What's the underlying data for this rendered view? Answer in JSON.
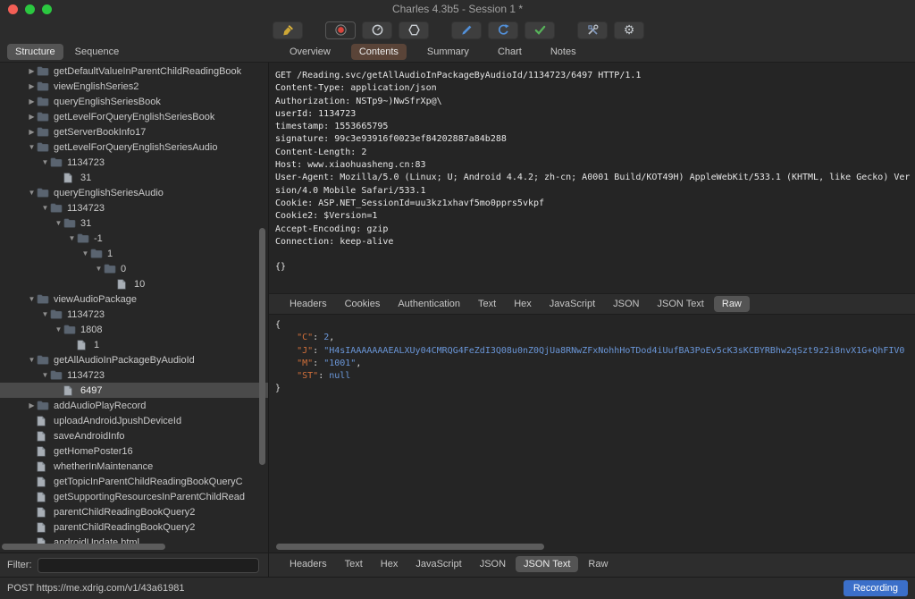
{
  "window": {
    "title": "Charles 4.3b5 - Session 1 *"
  },
  "toolbar": {
    "buttons": [
      {
        "name": "clear",
        "icon": "broom-icon",
        "active": false
      },
      {
        "name": "record",
        "icon": "record-icon",
        "active": true
      },
      {
        "name": "throttle",
        "icon": "throttle-icon",
        "active": false
      },
      {
        "name": "breakpoints",
        "icon": "breakpoints-hexagon-icon",
        "active": false
      },
      {
        "name": "compose",
        "icon": "compose-pencil-icon",
        "active": false
      },
      {
        "name": "repeat",
        "icon": "repeat-arrow-icon",
        "active": false
      },
      {
        "name": "validate",
        "icon": "validate-check-icon",
        "active": false
      },
      {
        "name": "tools",
        "icon": "tools-icon",
        "active": false
      },
      {
        "name": "settings",
        "icon": "settings-gear-icon",
        "active": false
      }
    ]
  },
  "main_tabs": {
    "items": [
      "Overview",
      "Contents",
      "Summary",
      "Chart",
      "Notes"
    ],
    "selected": "Contents"
  },
  "sidebar": {
    "tabs": {
      "items": [
        "Structure",
        "Sequence"
      ],
      "selected": "Structure"
    },
    "tree": [
      {
        "label": "getDefaultValueInParentChildReadingBook",
        "depth": 0,
        "kind": "folder",
        "state": "collapsed",
        "selected": false
      },
      {
        "label": "viewEnglishSeries2",
        "depth": 0,
        "kind": "folder",
        "state": "collapsed",
        "selected": false
      },
      {
        "label": "queryEnglishSeriesBook",
        "depth": 0,
        "kind": "folder",
        "state": "collapsed",
        "selected": false
      },
      {
        "label": "getLevelForQueryEnglishSeriesBook",
        "depth": 0,
        "kind": "folder",
        "state": "collapsed",
        "selected": false
      },
      {
        "label": "getServerBookInfo17",
        "depth": 0,
        "kind": "folder",
        "state": "collapsed",
        "selected": false
      },
      {
        "label": "getLevelForQueryEnglishSeriesAudio",
        "depth": 0,
        "kind": "folder",
        "state": "expanded",
        "selected": false
      },
      {
        "label": "1134723",
        "depth": 1,
        "kind": "folder",
        "state": "expanded",
        "selected": false
      },
      {
        "label": "31",
        "depth": 2,
        "kind": "file",
        "selected": false
      },
      {
        "label": "queryEnglishSeriesAudio",
        "depth": 0,
        "kind": "folder",
        "state": "expanded",
        "selected": false
      },
      {
        "label": "1134723",
        "depth": 1,
        "kind": "folder",
        "state": "expanded",
        "selected": false
      },
      {
        "label": "31",
        "depth": 2,
        "kind": "folder",
        "state": "expanded",
        "selected": false
      },
      {
        "label": "-1",
        "depth": 3,
        "kind": "folder",
        "state": "expanded",
        "selected": false
      },
      {
        "label": "1",
        "depth": 4,
        "kind": "folder",
        "state": "expanded",
        "selected": false
      },
      {
        "label": "0",
        "depth": 5,
        "kind": "folder",
        "state": "expanded",
        "selected": false
      },
      {
        "label": "10",
        "depth": 6,
        "kind": "file",
        "selected": false
      },
      {
        "label": "viewAudioPackage",
        "depth": 0,
        "kind": "folder",
        "state": "expanded",
        "selected": false
      },
      {
        "label": "1134723",
        "depth": 1,
        "kind": "folder",
        "state": "expanded",
        "selected": false
      },
      {
        "label": "1808",
        "depth": 2,
        "kind": "folder",
        "state": "expanded",
        "selected": false
      },
      {
        "label": "1",
        "depth": 3,
        "kind": "file",
        "selected": false
      },
      {
        "label": "getAllAudioInPackageByAudioId",
        "depth": 0,
        "kind": "folder",
        "state": "expanded",
        "selected": false
      },
      {
        "label": "1134723",
        "depth": 1,
        "kind": "folder",
        "state": "expanded",
        "selected": false
      },
      {
        "label": "6497",
        "depth": 2,
        "kind": "file",
        "selected": true
      },
      {
        "label": "addAudioPlayRecord",
        "depth": 0,
        "kind": "folder",
        "state": "collapsed",
        "selected": false
      },
      {
        "label": "uploadAndroidJpushDeviceId",
        "depth": 0,
        "kind": "file",
        "selected": false
      },
      {
        "label": "saveAndroidInfo",
        "depth": 0,
        "kind": "file",
        "selected": false
      },
      {
        "label": "getHomePoster16",
        "depth": 0,
        "kind": "file",
        "selected": false
      },
      {
        "label": "whetherInMaintenance",
        "depth": 0,
        "kind": "file",
        "selected": false
      },
      {
        "label": "getTopicInParentChildReadingBookQueryC",
        "depth": 0,
        "kind": "file",
        "selected": false
      },
      {
        "label": "getSupportingResourcesInParentChildRead",
        "depth": 0,
        "kind": "file",
        "selected": false
      },
      {
        "label": "parentChildReadingBookQuery2",
        "depth": 0,
        "kind": "file",
        "selected": false
      },
      {
        "label": "parentChildReadingBookQuery2",
        "depth": 0,
        "kind": "file",
        "selected": false
      },
      {
        "label": "androidUpdate.html",
        "depth": 0,
        "kind": "file",
        "selected": false
      }
    ],
    "filter": {
      "label": "Filter:",
      "value": ""
    }
  },
  "request": {
    "lines": [
      "GET /Reading.svc/getAllAudioInPackageByAudioId/1134723/6497 HTTP/1.1",
      "Content-Type: application/json",
      "Authorization: NSTp9~)NwSfrXp@\\",
      "userId: 1134723",
      "timestamp: 1553665795",
      "signature: 99c3e93916f0023ef84202887a84b288",
      "Content-Length: 2",
      "Host: www.xiaohuasheng.cn:83",
      "User-Agent: Mozilla/5.0 (Linux; U; Android 4.4.2; zh-cn; A0001 Build/KOT49H) AppleWebKit/533.1 (KHTML, like Gecko) Version/4.0 Mobile Safari/533.1",
      "Cookie: ASP.NET_SessionId=uu3kz1xhavf5mo0pprs5vkpf",
      "Cookie2: $Version=1",
      "Accept-Encoding: gzip",
      "Connection: keep-alive",
      "",
      "{}"
    ],
    "tabs": {
      "items": [
        "Headers",
        "Cookies",
        "Authentication",
        "Text",
        "Hex",
        "JavaScript",
        "JSON",
        "JSON Text",
        "Raw"
      ],
      "selected": "Raw"
    }
  },
  "response": {
    "json": {
      "open": "{",
      "entries": [
        {
          "key": "\"C\"",
          "value": "2",
          "comma": ","
        },
        {
          "key": "\"J\"",
          "value": "\"H4sIAAAAAAAEALXUy04CMRQG4FeZdI3Q08u0nZ0QjUa8RNwZFxNohhHoTDod4iUufBA3PoEv5cK3sKCBYRBhw2qSzt9z2i8nvX1G+QhFIV0",
          "comma": ""
        },
        {
          "key": "\"M\"",
          "value": "\"1001\"",
          "comma": ","
        },
        {
          "key": "\"ST\"",
          "value": "null",
          "comma": ""
        }
      ],
      "close": "}"
    },
    "tabs": {
      "items": [
        "Headers",
        "Text",
        "Hex",
        "JavaScript",
        "JSON",
        "JSON Text",
        "Raw"
      ],
      "selected": "JSON Text"
    }
  },
  "status_bar": {
    "message": "POST https://me.xdrig.com/v1/43a61981",
    "recording": "Recording"
  }
}
